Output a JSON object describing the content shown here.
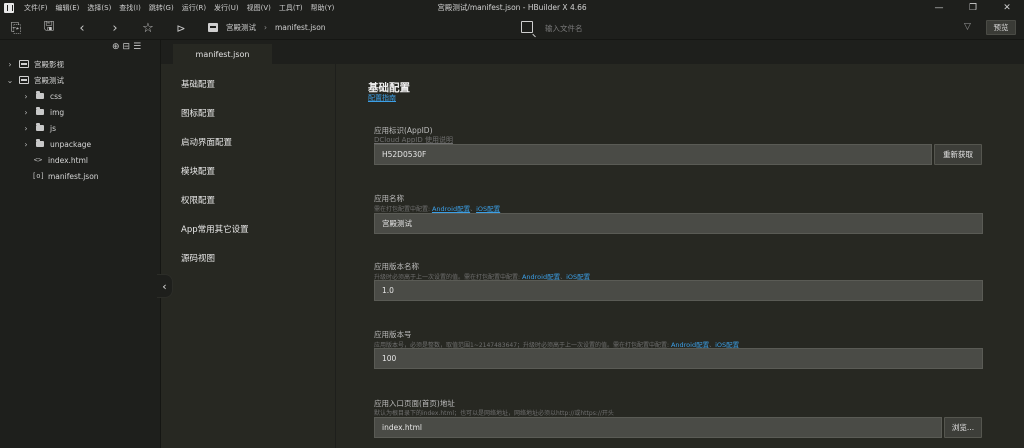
{
  "menu": [
    "文件(F)",
    "编辑(E)",
    "选择(S)",
    "查找(I)",
    "跳转(G)",
    "运行(R)",
    "发行(U)",
    "视图(V)",
    "工具(T)",
    "帮助(Y)"
  ],
  "window_title": "宫殿测试/manifest.json - HBuilder X 4.66",
  "toolbar": {
    "breadcrumb": [
      "宫殿测试",
      "manifest.json"
    ],
    "search_placeholder": "输入文件名",
    "preview_label": "预览"
  },
  "sidebar": {
    "items": [
      {
        "label": "宫殿影视",
        "type": "project",
        "expanded": false
      },
      {
        "label": "宫殿测试",
        "type": "project",
        "expanded": true
      },
      {
        "label": "css",
        "type": "folder"
      },
      {
        "label": "img",
        "type": "folder"
      },
      {
        "label": "js",
        "type": "folder"
      },
      {
        "label": "unpackage",
        "type": "folder"
      },
      {
        "label": "index.html",
        "type": "html",
        "glyph": "<>"
      },
      {
        "label": "manifest.json",
        "type": "json",
        "glyph": "[o]"
      }
    ]
  },
  "editor": {
    "tab": "manifest.json"
  },
  "nav": [
    "基础配置",
    "图标配置",
    "启动界面配置",
    "模块配置",
    "权限配置",
    "App常用其它设置",
    "源码视图"
  ],
  "content": {
    "title": "基础配置",
    "doc_link": "配置指南",
    "appid": {
      "label": "应用标识(AppID)",
      "link": "DCloud AppID 使用说明",
      "value": "H52D0530F",
      "button": "重新获取"
    },
    "app_name": {
      "label": "应用名称",
      "hint": "需在打包配置中配置: ",
      "link_android": "Android配置",
      "link_ios": "iOS配置",
      "value": "宫殿测试"
    },
    "version_name": {
      "label": "应用版本名称",
      "hint": "升级时必须高于上一次设置的值。需在打包配置中配置: ",
      "link_android": "Android配置",
      "link_ios": "iOS配置",
      "value": "1.0"
    },
    "version_code": {
      "label": "应用版本号",
      "hint": "应用版本号，必须是整数，取值范围1~2147483647；升级时必须高于上一次设置的值。需在打包配置中配置: ",
      "link_android": "Android配置",
      "link_ios": "iOS配置",
      "value": "100"
    },
    "entry_page": {
      "label": "应用入口页面(首页)地址",
      "hint": "默认为根目录下的index.html；也可以是网络地址，网络地址必须以http://或https://开头",
      "value": "index.html",
      "button": "浏览..."
    }
  }
}
